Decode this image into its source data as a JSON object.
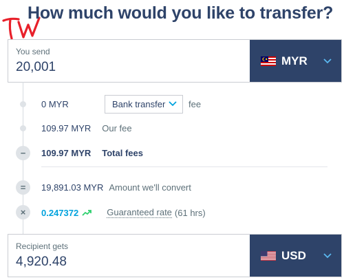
{
  "title": "How much would you like to transfer?",
  "logo_text": "TW",
  "send": {
    "label": "You send",
    "amount": "20,001",
    "currency": "MYR",
    "flag": "malaysia-flag-icon"
  },
  "fees": {
    "method_amount": "0 MYR",
    "method_select": "Bank transfer",
    "method_suffix": "fee",
    "our_fee_amount": "109.97 MYR",
    "our_fee_label": "Our fee",
    "total_amount": "109.97 MYR",
    "total_label": "Total fees",
    "total_symbol": "−"
  },
  "conversion": {
    "convert_amount": "19,891.03 MYR",
    "convert_label": "Amount we'll convert",
    "convert_symbol": "=",
    "rate": "0.247372",
    "rate_label": "Guaranteed rate",
    "rate_duration": "(61 hrs)",
    "rate_symbol": "×"
  },
  "receive": {
    "label": "Recipient gets",
    "amount": "4,920.48",
    "currency": "USD",
    "flag": "us-flag-icon"
  },
  "colors": {
    "navy": "#2e4369",
    "accent_blue": "#00a2dd",
    "trend_green": "#2ed06e",
    "logo_red": "#e8202a"
  }
}
